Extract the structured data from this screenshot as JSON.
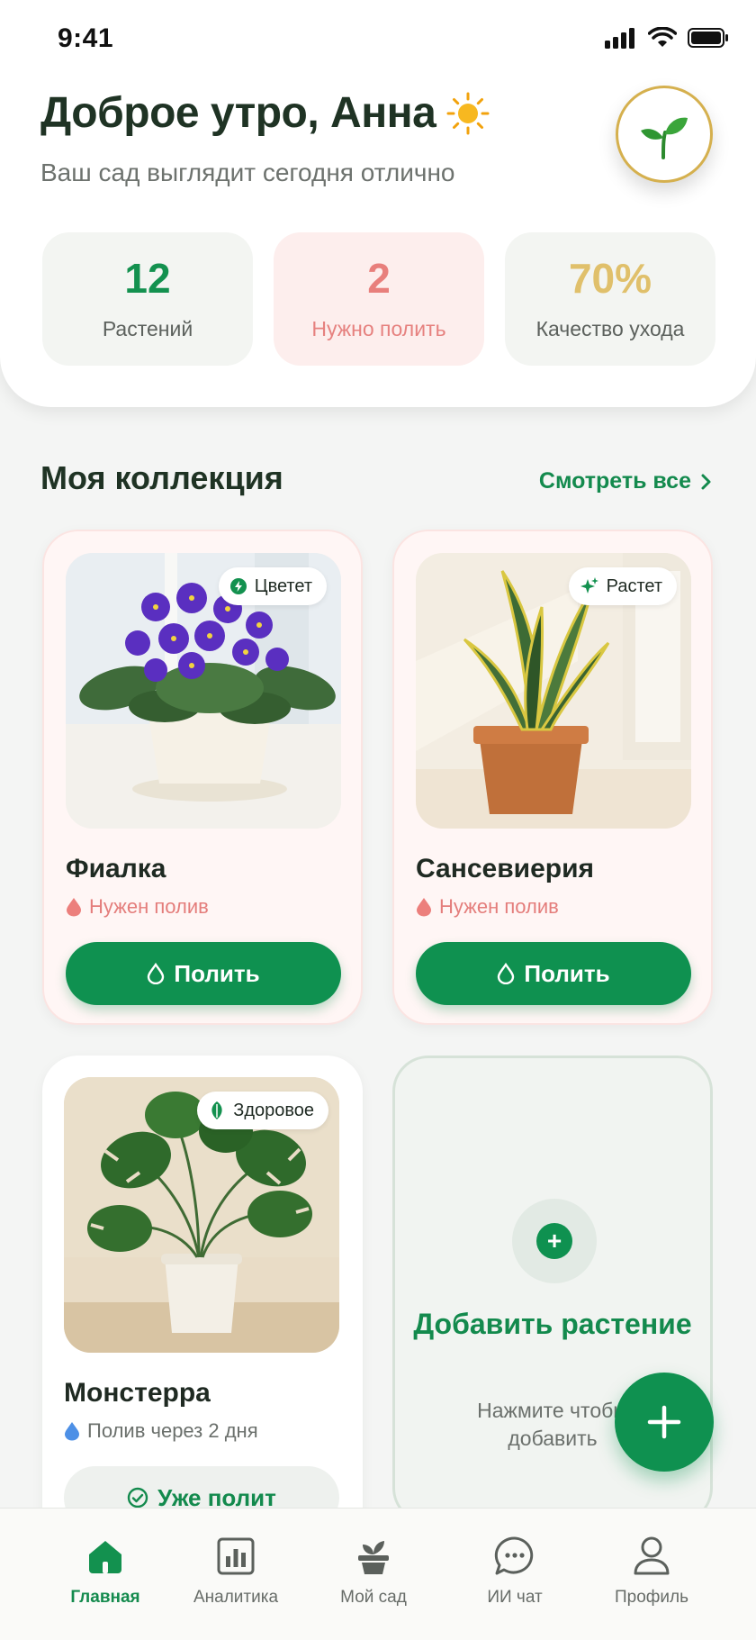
{
  "status_bar": {
    "time": "9:41"
  },
  "header": {
    "greeting": "Доброе утро, Анна",
    "subtitle": "Ваш сад выглядит сегодня отлично"
  },
  "stats": [
    {
      "value": "12",
      "label": "Растений",
      "color": "#13914f"
    },
    {
      "value": "2",
      "label": "Нужно полить",
      "color": "#e87f7c"
    },
    {
      "value": "70%",
      "label": "Качество ухода",
      "color": "#e0c06b"
    }
  ],
  "collection": {
    "title": "Моя коллекция",
    "see_all": "Смотреть все"
  },
  "plants": [
    {
      "name": "Фиалка",
      "badge": "Цветет",
      "status": "Нужен полив",
      "action": "Полить"
    },
    {
      "name": "Сансевиерия",
      "badge": "Растет",
      "status": "Нужен полив",
      "action": "Полить"
    },
    {
      "name": "Монстерра",
      "badge": "Здоровое",
      "status": "Полив через 2 дня",
      "action": "Уже полит"
    }
  ],
  "add_card": {
    "title": "Добавить растение",
    "subtitle": "Нажмите чтобы добавить"
  },
  "nav": [
    {
      "label": "Главная",
      "icon": "home-icon",
      "active": true
    },
    {
      "label": "Аналитика",
      "icon": "analytics-icon",
      "active": false
    },
    {
      "label": "Мой сад",
      "icon": "plant-pot-icon",
      "active": false
    },
    {
      "label": "ИИ чат",
      "icon": "chat-icon",
      "active": false
    },
    {
      "label": "Профиль",
      "icon": "profile-icon",
      "active": false
    }
  ],
  "colors": {
    "primary": "#0f9150",
    "alert": "#e47d7b",
    "gold": "#d5b04e",
    "text": "#1f3324"
  }
}
